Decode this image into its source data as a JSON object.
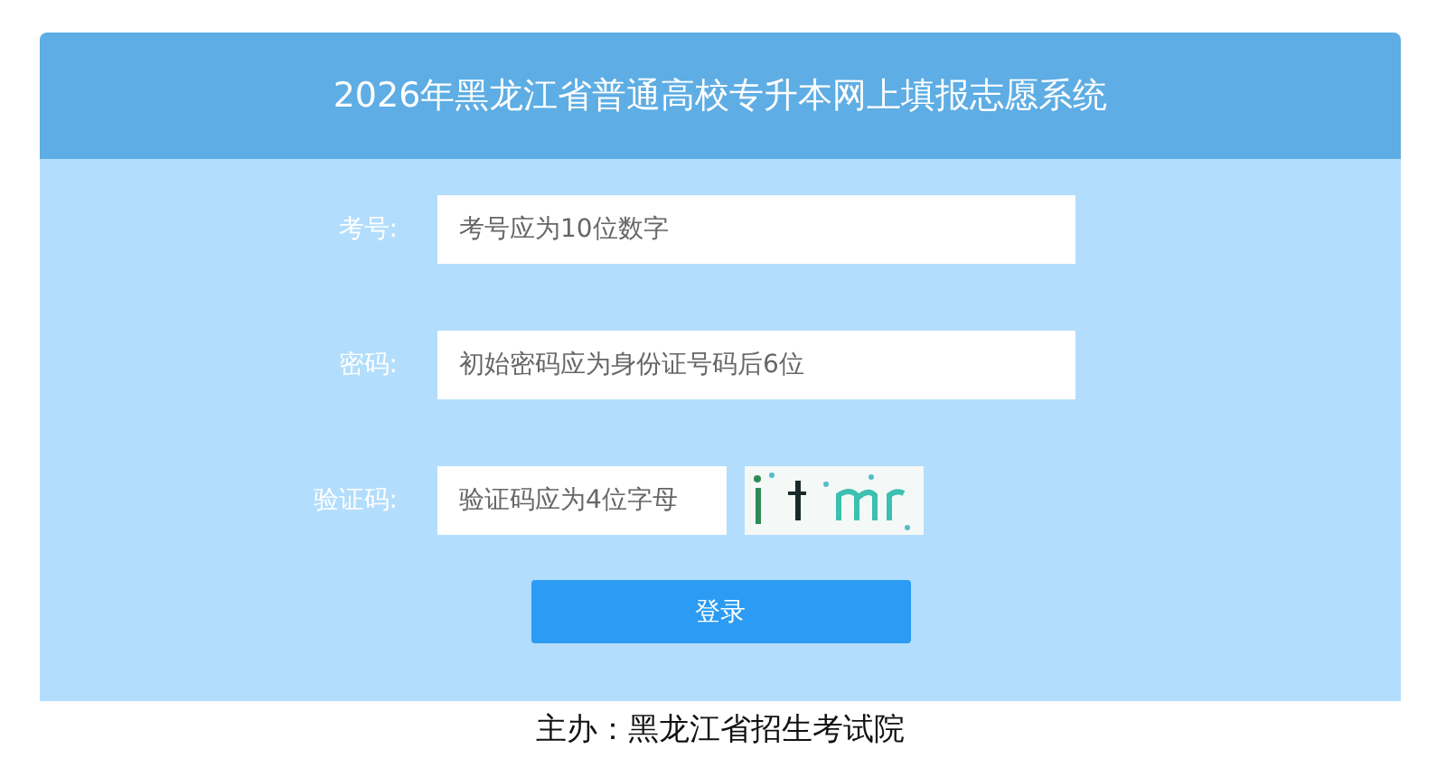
{
  "header": {
    "title": "2026年黑龙江省普通高校专升本网上填报志愿系统"
  },
  "form": {
    "fields": [
      {
        "kind": "text",
        "label": "考号:",
        "placeholder": "考号应为10位数字"
      },
      {
        "kind": "password",
        "label": "密码:",
        "placeholder": "初始密码应为身份证号码后6位"
      },
      {
        "kind": "captcha",
        "label": "验证码:",
        "placeholder": "验证码应为4位字母"
      }
    ],
    "submit": "登录"
  },
  "footer": {
    "text": "主办：黑龙江省招生考试院"
  }
}
